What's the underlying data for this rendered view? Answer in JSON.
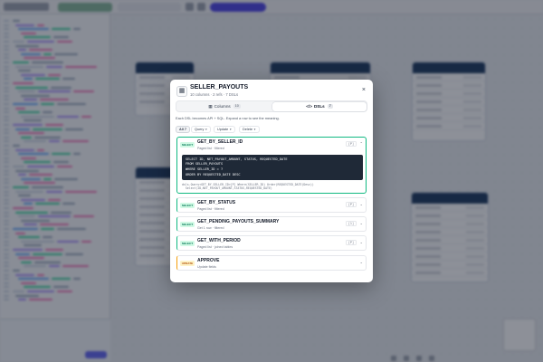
{
  "modal": {
    "icon": "table-icon",
    "title": "SELLER_PAYOUTS",
    "subtitle": "10 columns · 2 refs · 7 DSLs",
    "close_label": "×",
    "tabs": [
      {
        "label": "Columns",
        "count": "10",
        "icon": "columns-icon",
        "active": false
      },
      {
        "label": "DSLs",
        "count": "7",
        "icon": "code-icon",
        "active": true
      }
    ],
    "description": "Each DSL becomes API + SQL. Expand a row to see the meaning.",
    "filters": [
      {
        "label": "All 7",
        "active": true
      },
      {
        "label": "Query",
        "active": false
      },
      {
        "label": "Update",
        "active": false
      },
      {
        "label": "Delete",
        "active": false
      }
    ],
    "dsls": [
      {
        "kind": "SELECT",
        "name": "GET_BY_SELLER_ID",
        "meta": "Paged list · filtered",
        "params": "[P]",
        "expanded": true,
        "sql": [
          "SELECT ID, NET_PAYOUT_AMOUNT, STATUS, REQUESTED_DATE",
          "FROM SELLER_PAYOUTS",
          "WHERE SELLER_ID = ?",
          "ORDER BY REQUESTED_DATE DESC"
        ],
        "dsl": [
          "dsls.Query<GET_BY_SELLER_ID>[P] Where(SELLER_ID) Order(REQUESTED_DATE(Desc))",
          "  Select(ID,NET_PAYOUT_AMOUNT,STATUS,REQUESTED_DATE)"
        ]
      },
      {
        "kind": "SELECT",
        "name": "GET_BY_STATUS",
        "meta": "Paged list · filtered",
        "params": "[P]",
        "expanded": false
      },
      {
        "kind": "SELECT",
        "name": "GET_PENDING_PAYOUTS_SUMMARY",
        "meta": "Get 1 row · filtered",
        "params": "[1]",
        "expanded": false
      },
      {
        "kind": "SELECT",
        "name": "GET_WITH_PERIOD",
        "meta": "Paged list · joined tables",
        "params": "[P]",
        "expanded": false
      },
      {
        "kind": "UPDATE",
        "name": "APPROVE",
        "meta": "Update fields",
        "params": "",
        "expanded": false
      }
    ]
  },
  "colors": {
    "select": "#10b981",
    "update": "#f59e0b",
    "header": "#1e3a5f",
    "accent": "#4f46e5"
  }
}
